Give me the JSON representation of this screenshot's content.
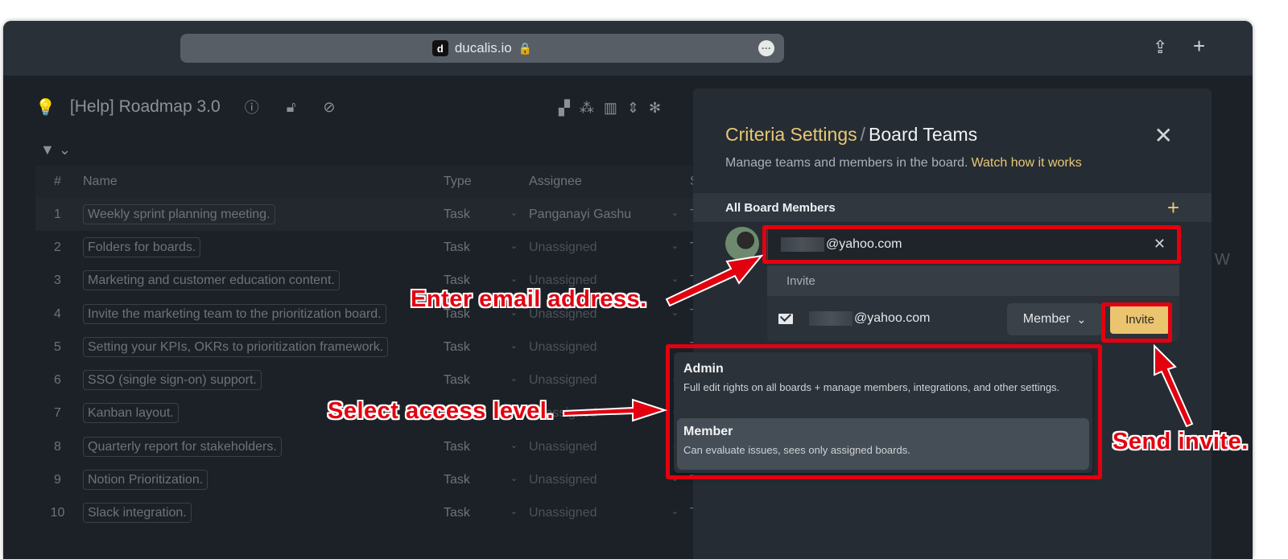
{
  "browser": {
    "favicon_letter": "d",
    "url": "ducalis.io",
    "lock_glyph": "🔒",
    "more_glyph": "•••",
    "share_glyph": "⇪",
    "newtab_glyph": "+"
  },
  "board": {
    "title": "[Help] Roadmap 3.0",
    "columns": {
      "num": "#",
      "name": "Name",
      "type": "Type",
      "assignee": "Assignee",
      "s": "S"
    },
    "rows": [
      {
        "num": "1",
        "name": "Weekly sprint planning meeting.",
        "type": "Task",
        "assignee": "Panganayi Gashu",
        "s": "T"
      },
      {
        "num": "2",
        "name": "Folders for boards.",
        "type": "Task",
        "assignee": "Unassigned",
        "s": "T"
      },
      {
        "num": "3",
        "name": "Marketing and customer education content.",
        "type": "Task",
        "assignee": "Unassigned",
        "s": "T"
      },
      {
        "num": "4",
        "name": "Invite the marketing team to the prioritization board.",
        "type": "Task",
        "assignee": "Unassigned",
        "s": "T"
      },
      {
        "num": "5",
        "name": "Setting your KPIs, OKRs to prioritization framework.",
        "type": "Task",
        "assignee": "Unassigned",
        "s": "T"
      },
      {
        "num": "6",
        "name": "SSO (single sign-on) support.",
        "type": "Task",
        "assignee": "Unassigned",
        "s": "T"
      },
      {
        "num": "7",
        "name": "Kanban layout.",
        "type": "Task",
        "assignee": "Unassigned",
        "s": "T"
      },
      {
        "num": "8",
        "name": "Quarterly report for stakeholders.",
        "type": "Task",
        "assignee": "Unassigned",
        "s": "T"
      },
      {
        "num": "9",
        "name": "Notion Prioritization.",
        "type": "Task",
        "assignee": "Unassigned",
        "s": "T"
      },
      {
        "num": "10",
        "name": "Slack integration.",
        "type": "Task",
        "assignee": "Unassigned",
        "s": "T"
      }
    ]
  },
  "panel": {
    "crumb": "Criteria Settings",
    "sep": "/",
    "title": "Board Teams",
    "close_glyph": "✕",
    "subtitle": "Manage teams and members in the board.",
    "subtitle_link": "Watch how it works",
    "section_label": "All Board Members",
    "add_glyph": "+",
    "email_value": "@yahoo.com",
    "clear_glyph": "✕",
    "dropdown_header": "Invite",
    "suggestion_email": "@yahoo.com",
    "role_selected": "Member",
    "role_chevron": "⌄",
    "invite_button": "Invite"
  },
  "roles_menu": [
    {
      "name": "Admin",
      "desc": "Full edit rights on all boards + manage members, integrations, and other settings."
    },
    {
      "name": "Member",
      "desc": "Can evaluate issues, sees only assigned boards."
    }
  ],
  "annotations": {
    "enter_email": "Enter email address.",
    "select_access": "Select access level.",
    "send_invite": "Send invite."
  },
  "colors": {
    "accent": "#e8c875",
    "invite_button": "#eac46f",
    "annotation_red": "#e3000f"
  }
}
